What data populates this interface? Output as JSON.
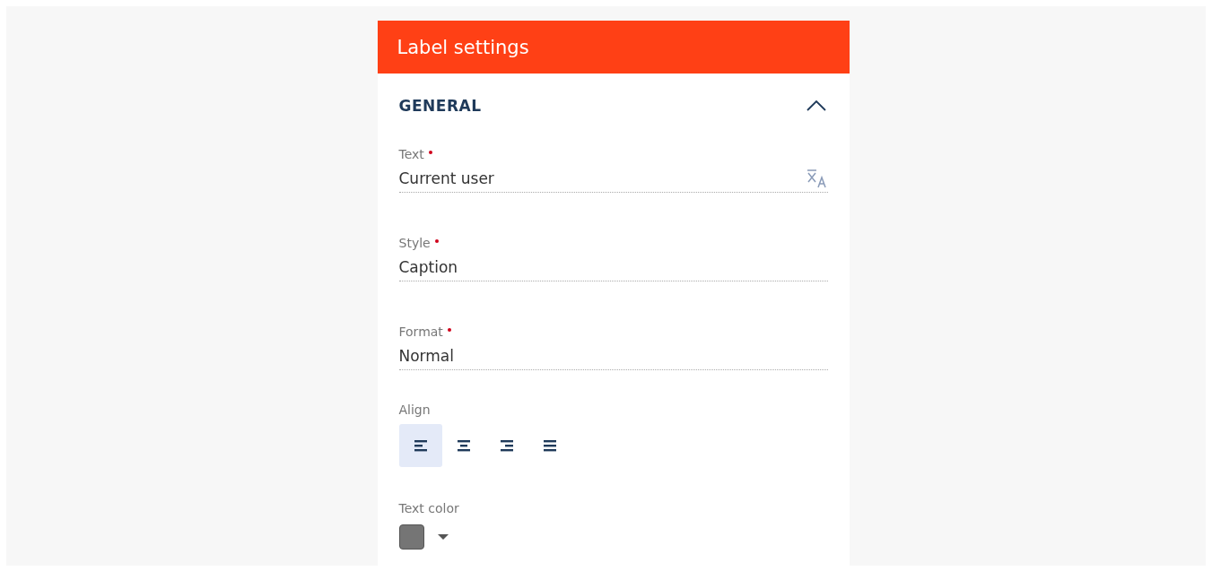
{
  "panel": {
    "title": "Label settings"
  },
  "section": {
    "title": "GENERAL",
    "expanded": true
  },
  "fields": [
    {
      "kind": "translatable",
      "label": "Text",
      "required": true,
      "value": "Current user"
    },
    {
      "kind": "select",
      "label": "Style",
      "required": true,
      "value": "Caption"
    },
    {
      "kind": "select",
      "label": "Format",
      "required": true,
      "value": "Normal"
    }
  ],
  "align": {
    "label": "Align",
    "options": [
      {
        "kind": "left",
        "selected": true
      },
      {
        "kind": "center",
        "selected": false
      },
      {
        "kind": "right",
        "selected": false
      },
      {
        "kind": "justify",
        "selected": false
      }
    ]
  },
  "text_color": {
    "label": "Text color",
    "color": "#757575"
  }
}
